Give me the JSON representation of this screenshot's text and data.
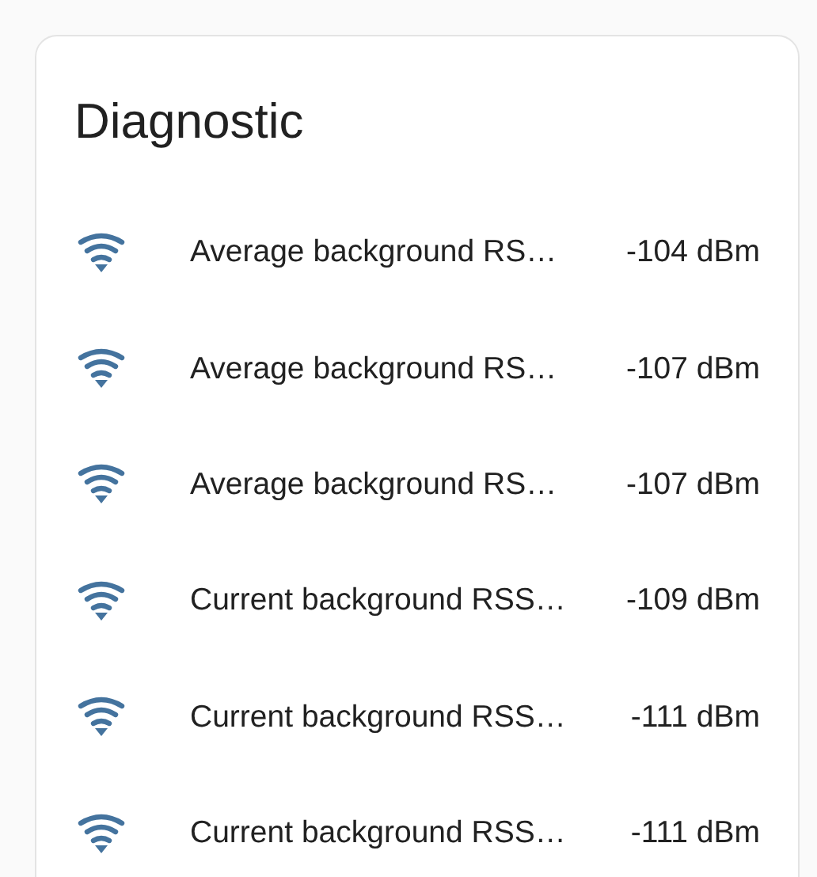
{
  "card": {
    "title": "Diagnostic",
    "rows": [
      {
        "label": "Average background RS…",
        "value": "-104 dBm"
      },
      {
        "label": "Average background RS…",
        "value": "-107 dBm"
      },
      {
        "label": "Average background RS…",
        "value": "-107 dBm"
      },
      {
        "label": "Current background RSS…",
        "value": "-109 dBm"
      },
      {
        "label": "Current background RSS…",
        "value": "-111 dBm"
      },
      {
        "label": "Current background RSS…",
        "value": "-111 dBm"
      }
    ]
  }
}
